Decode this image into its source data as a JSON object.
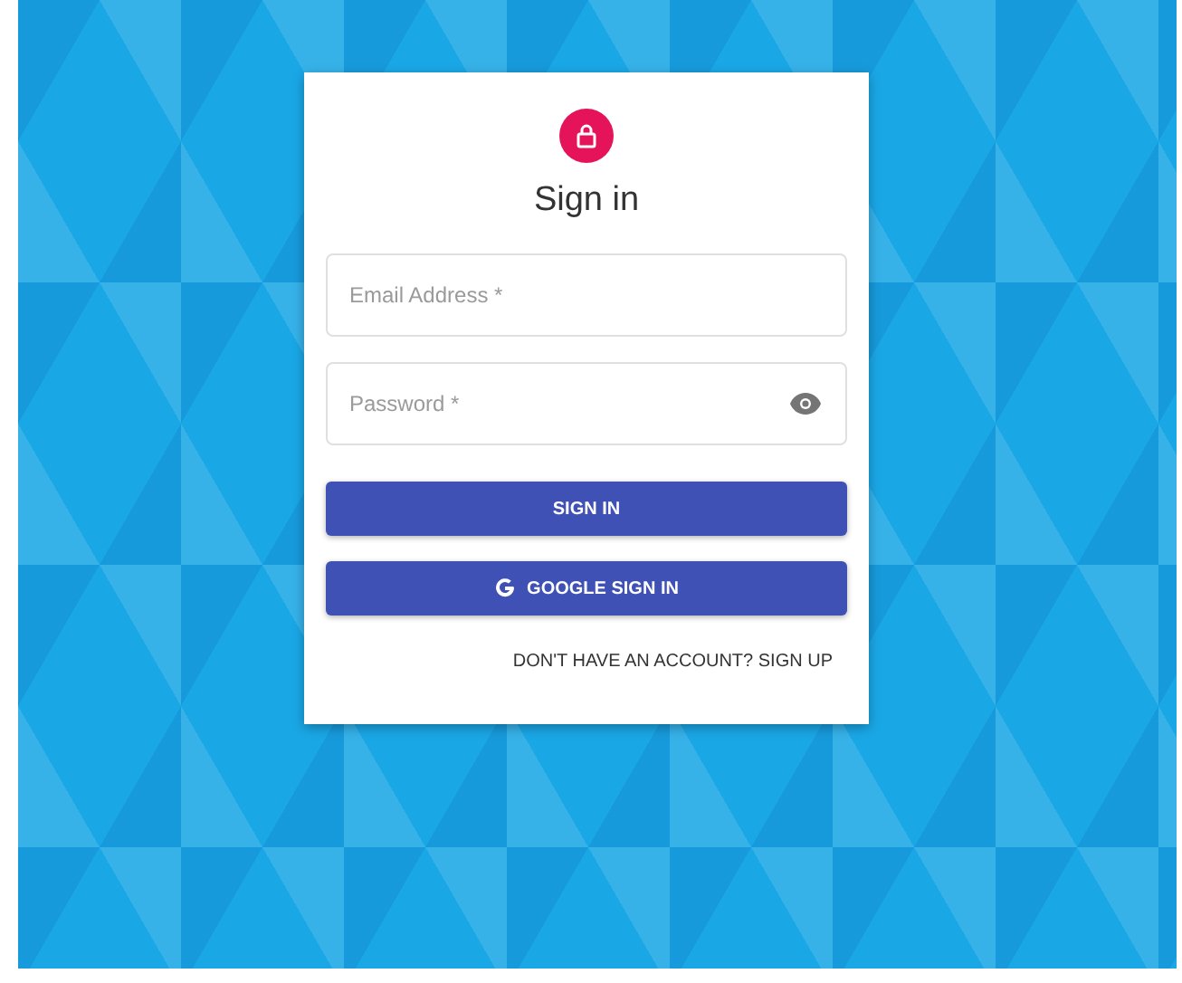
{
  "card": {
    "title": "Sign in",
    "fields": [
      {
        "placeholder": "Email Address *",
        "kind": "text"
      },
      {
        "placeholder": "Password *",
        "kind": "password"
      }
    ],
    "buttons": [
      {
        "label": "SIGN IN",
        "kind": "plain"
      },
      {
        "label": "GOOGLE SIGN IN",
        "kind": "google"
      }
    ],
    "link": "DON'T HAVE AN ACCOUNT? SIGN UP"
  }
}
